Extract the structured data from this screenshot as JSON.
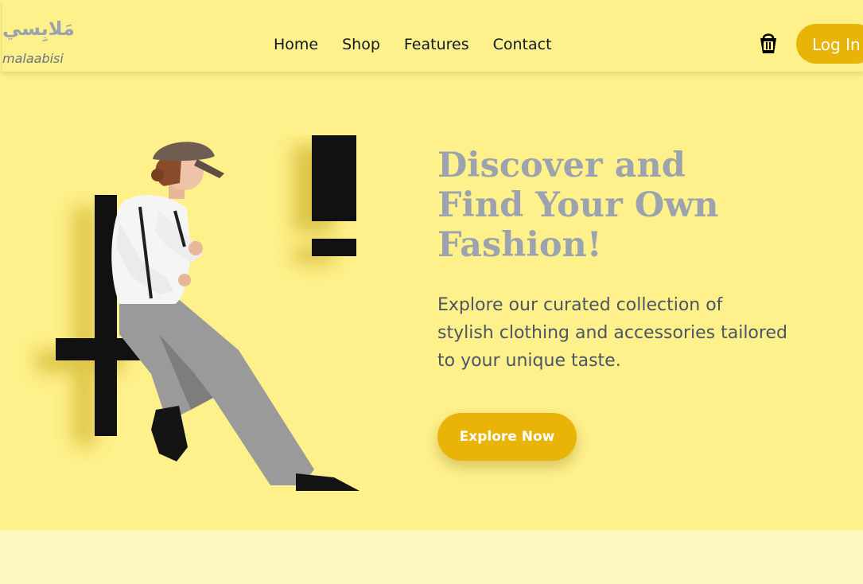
{
  "brand": {
    "name_arabic": "مَلابِسي",
    "name_latin": "malaabisi"
  },
  "nav": {
    "items": [
      {
        "label": "Home"
      },
      {
        "label": "Shop"
      },
      {
        "label": "Features"
      },
      {
        "label": "Contact"
      }
    ],
    "cart_icon": "shopping-bag-icon",
    "login_label": "Log In"
  },
  "hero": {
    "title_lines": [
      "Discover and",
      "Find Your Own",
      "Fashion!"
    ],
    "description_lines": [
      "Explore our curated collection of",
      "stylish clothing and accessories tailored",
      "to your unique taste."
    ],
    "cta_label": "Explore Now",
    "image_subject": "model in cap, white shirt and grey trousers seated on a black plus sign, black exclamation mark behind"
  },
  "colors": {
    "page_background": "#fef08a",
    "accent": "#eab308",
    "title": "#9ca3af",
    "body_text": "#4b5563",
    "next_section": "#fef7c0"
  }
}
